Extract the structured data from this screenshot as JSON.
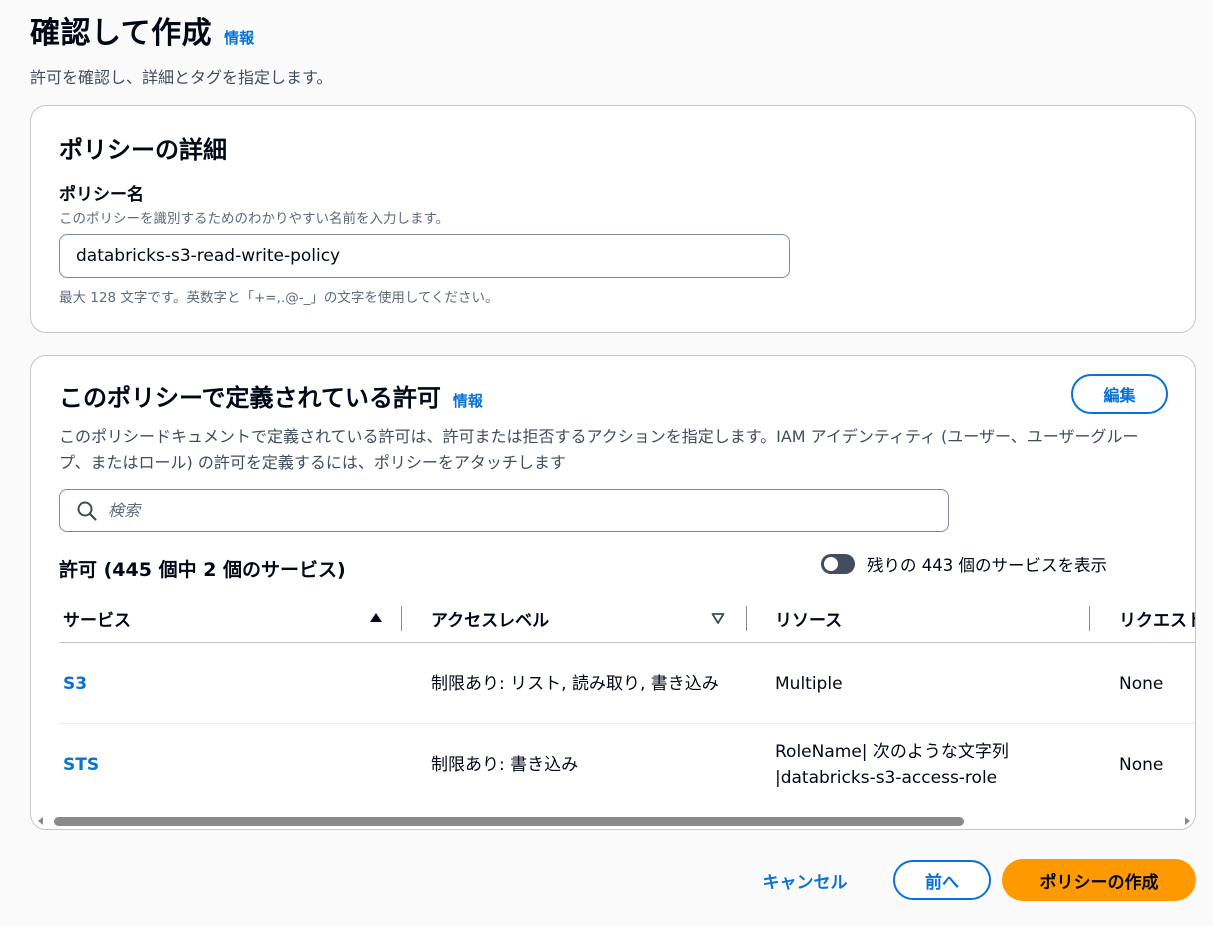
{
  "header": {
    "title": "確認して作成",
    "info_link": "情報",
    "description": "許可を確認し、詳細とタグを指定します。"
  },
  "policy_details": {
    "title": "ポリシーの詳細",
    "name_label": "ポリシー名",
    "name_description": "このポリシーを識別するためのわかりやすい名前を入力します。",
    "name_value": "databricks-s3-read-write-policy",
    "name_constraint": "最大 128 文字です。英数字と「+=,.@-_」の文字を使用してください。"
  },
  "permissions": {
    "title": "このポリシーで定義されている許可",
    "info_link": "情報",
    "edit_button": "編集",
    "description": "このポリシードキュメントで定義されている許可は、許可または拒否するアクションを指定します。IAM アイデンティティ (ユーザー、ユーザーグループ、またはロール) の許可を定義するには、ポリシーをアタッチします",
    "search_placeholder": "検索",
    "count_label": "許可 (445 個中 2 個のサービス)",
    "toggle_label": "残りの 443 個のサービスを表示",
    "toggle_on": false,
    "columns": {
      "service": "サービス",
      "access_level": "アクセスレベル",
      "resource": "リソース",
      "request": "リクエスト"
    },
    "rows": [
      {
        "service": "S3",
        "access_level": "制限あり: リスト, 読み取り, 書き込み",
        "resource": "Multiple",
        "request": "None"
      },
      {
        "service": "STS",
        "access_level": "制限あり: 書き込み",
        "resource": "RoleName| 次のような文字列 |databricks-s3-access-role",
        "request": "None"
      }
    ]
  },
  "footer": {
    "cancel": "キャンセル",
    "previous": "前へ",
    "create": "ポリシーの作成"
  },
  "colors": {
    "link": "#0972d3",
    "primary_button": "#ff9900",
    "text": "#000716",
    "secondary_text": "#5f6b7a"
  },
  "icons": [
    "search-icon",
    "sort-ascending-icon",
    "sort-descending-icon",
    "scroll-left-arrow-icon",
    "scroll-right-arrow-icon"
  ]
}
